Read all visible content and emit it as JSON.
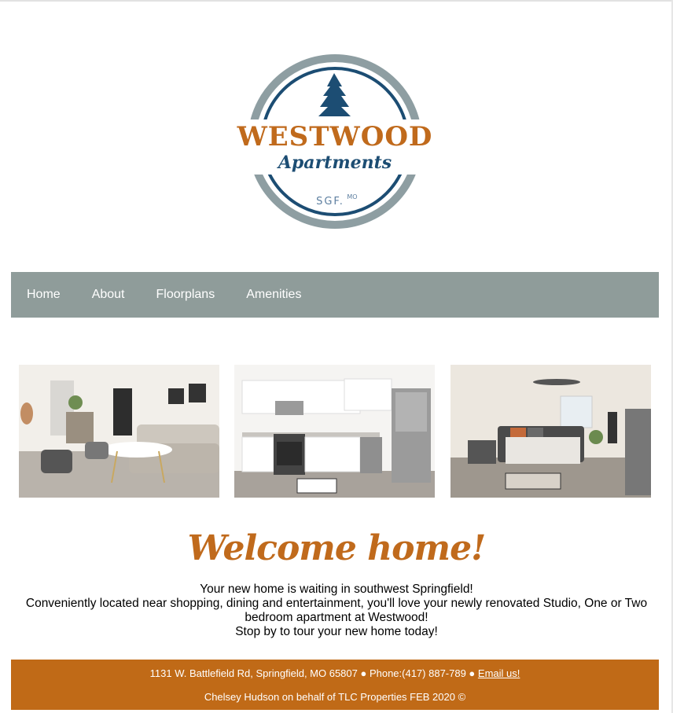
{
  "logo": {
    "brand": "WESTWOOD",
    "sub": "Apartments",
    "city": "SGF.",
    "state": "MO"
  },
  "nav": {
    "items": [
      "Home",
      "About",
      "Floorplans",
      "Amenities"
    ]
  },
  "gallery": {
    "photos": [
      {
        "subject": "living room"
      },
      {
        "subject": "kitchen"
      },
      {
        "subject": "bedroom"
      }
    ]
  },
  "welcome": {
    "heading": "Welcome home!",
    "line1": "Your new home is waiting in southwest Springfield!",
    "line2": "Conveniently located near shopping, dining and entertainment, you'll love your newly renovated Studio, One or Two bedroom apartment at Westwood!",
    "line3": "Stop by to tour your new home today!"
  },
  "footer": {
    "contact": "1131 W. Battlefield Rd, Springfield, MO 65807 ● Phone:(417) 887-789 ●",
    "email_link": "Email us!",
    "credit": "Chelsey Hudson on behalf of TLC Properties FEB 2020 ©"
  },
  "colors": {
    "nav_bg": "#8f9c9a",
    "accent_orange": "#c06a17",
    "logo_navy": "#1c4d73",
    "logo_grey": "#8e9ea2"
  }
}
